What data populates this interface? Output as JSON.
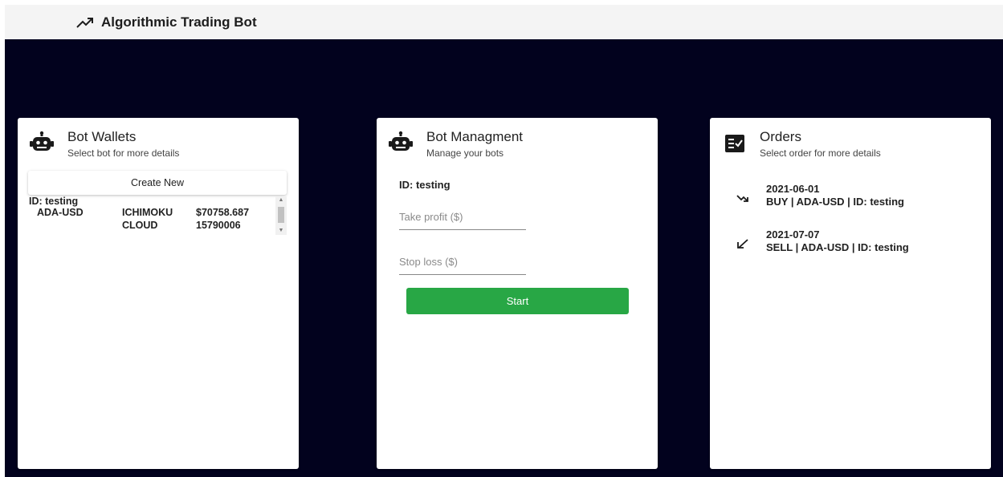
{
  "app": {
    "title": "Algorithmic Trading Bot"
  },
  "wallets": {
    "title": "Bot Wallets",
    "subtitle": "Select bot for more details",
    "create_label": "Create New",
    "items": [
      {
        "id_label": "ID: testing",
        "pair": "ADA-USD",
        "strategy_line1": "ICHIMOKU",
        "strategy_line2": "CLOUD",
        "balance_line1": "$70758.687",
        "balance_line2": "15790006"
      }
    ]
  },
  "management": {
    "title": "Bot Managment",
    "subtitle": "Manage your bots",
    "bot_id_label": "ID: testing",
    "take_profit_placeholder": "Take profit ($)",
    "stop_loss_placeholder": "Stop loss ($)",
    "start_label": "Start",
    "start_color": "#28a745"
  },
  "orders": {
    "title": "Orders",
    "subtitle": "Select order for more details",
    "items": [
      {
        "date": "2021-06-01",
        "desc": "BUY | ADA-USD | ID: testing",
        "icon": "trending-down-icon"
      },
      {
        "date": "2021-07-07",
        "desc": "SELL | ADA-USD | ID: testing",
        "icon": "call-received-icon"
      }
    ]
  },
  "theme": {
    "stage_bg": "#02021e",
    "appbar_bg": "#f4f4f4"
  }
}
